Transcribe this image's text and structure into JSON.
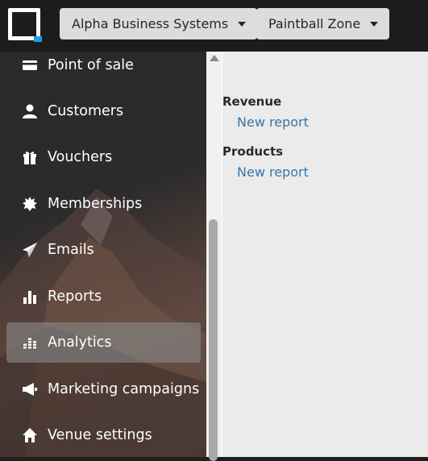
{
  "header": {
    "org_dropdown": "Alpha Business Systems",
    "venue_dropdown": "Paintball Zone"
  },
  "sidebar": {
    "items": [
      {
        "label": "Point of sale",
        "icon": "credit-card-icon"
      },
      {
        "label": "Customers",
        "icon": "user-icon"
      },
      {
        "label": "Vouchers",
        "icon": "gift-icon"
      },
      {
        "label": "Memberships",
        "icon": "badge-icon"
      },
      {
        "label": "Emails",
        "icon": "paper-plane-icon"
      },
      {
        "label": "Reports",
        "icon": "bar-chart-icon"
      },
      {
        "label": "Analytics",
        "icon": "equalizer-icon",
        "active": true
      },
      {
        "label": "Marketing campaigns",
        "icon": "megaphone-icon"
      },
      {
        "label": "Venue settings",
        "icon": "home-icon"
      }
    ]
  },
  "content": {
    "sections": [
      {
        "title": "Revenue",
        "link": "New report"
      },
      {
        "title": "Products",
        "link": "New report"
      }
    ]
  },
  "colors": {
    "link": "#3a74a8",
    "accent": "#1ea0e0",
    "topbar": "#1c1c1c",
    "content_bg": "#ebebeb"
  }
}
